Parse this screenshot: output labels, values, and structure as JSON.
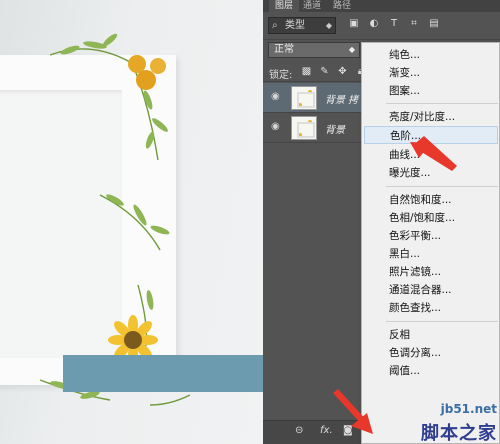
{
  "panel": {
    "tabs": [
      "图层",
      "通道",
      "路径"
    ],
    "filter_kind": "类型",
    "blend_mode": "正常",
    "lock_label": "锁定:",
    "layers": [
      {
        "name": "背景 拷",
        "selected": true
      },
      {
        "name": "背景",
        "selected": false
      }
    ],
    "bottom_icons": [
      "link-icon",
      "fx-icon",
      "mask-icon",
      "adjustment-icon"
    ],
    "bottom_fx_label": "fx."
  },
  "menu": {
    "items": [
      "纯色...",
      "渐变...",
      "图案...",
      "亮度/对比度...",
      "色阶...",
      "曲线...",
      "曝光度...",
      "自然饱和度...",
      "色相/饱和度...",
      "色彩平衡...",
      "黑白...",
      "照片滤镜...",
      "通道混合器...",
      "颜色查找...",
      "反相",
      "色调分离...",
      "阈值..."
    ],
    "highlighted": "色阶..."
  },
  "watermark": {
    "line1": "jb51.net",
    "line2": "脚本之家"
  },
  "colors": {
    "overlay_bar": "#6c9aae",
    "arrow": "#e8372b",
    "menu_highlight": "#e2ecf6"
  }
}
